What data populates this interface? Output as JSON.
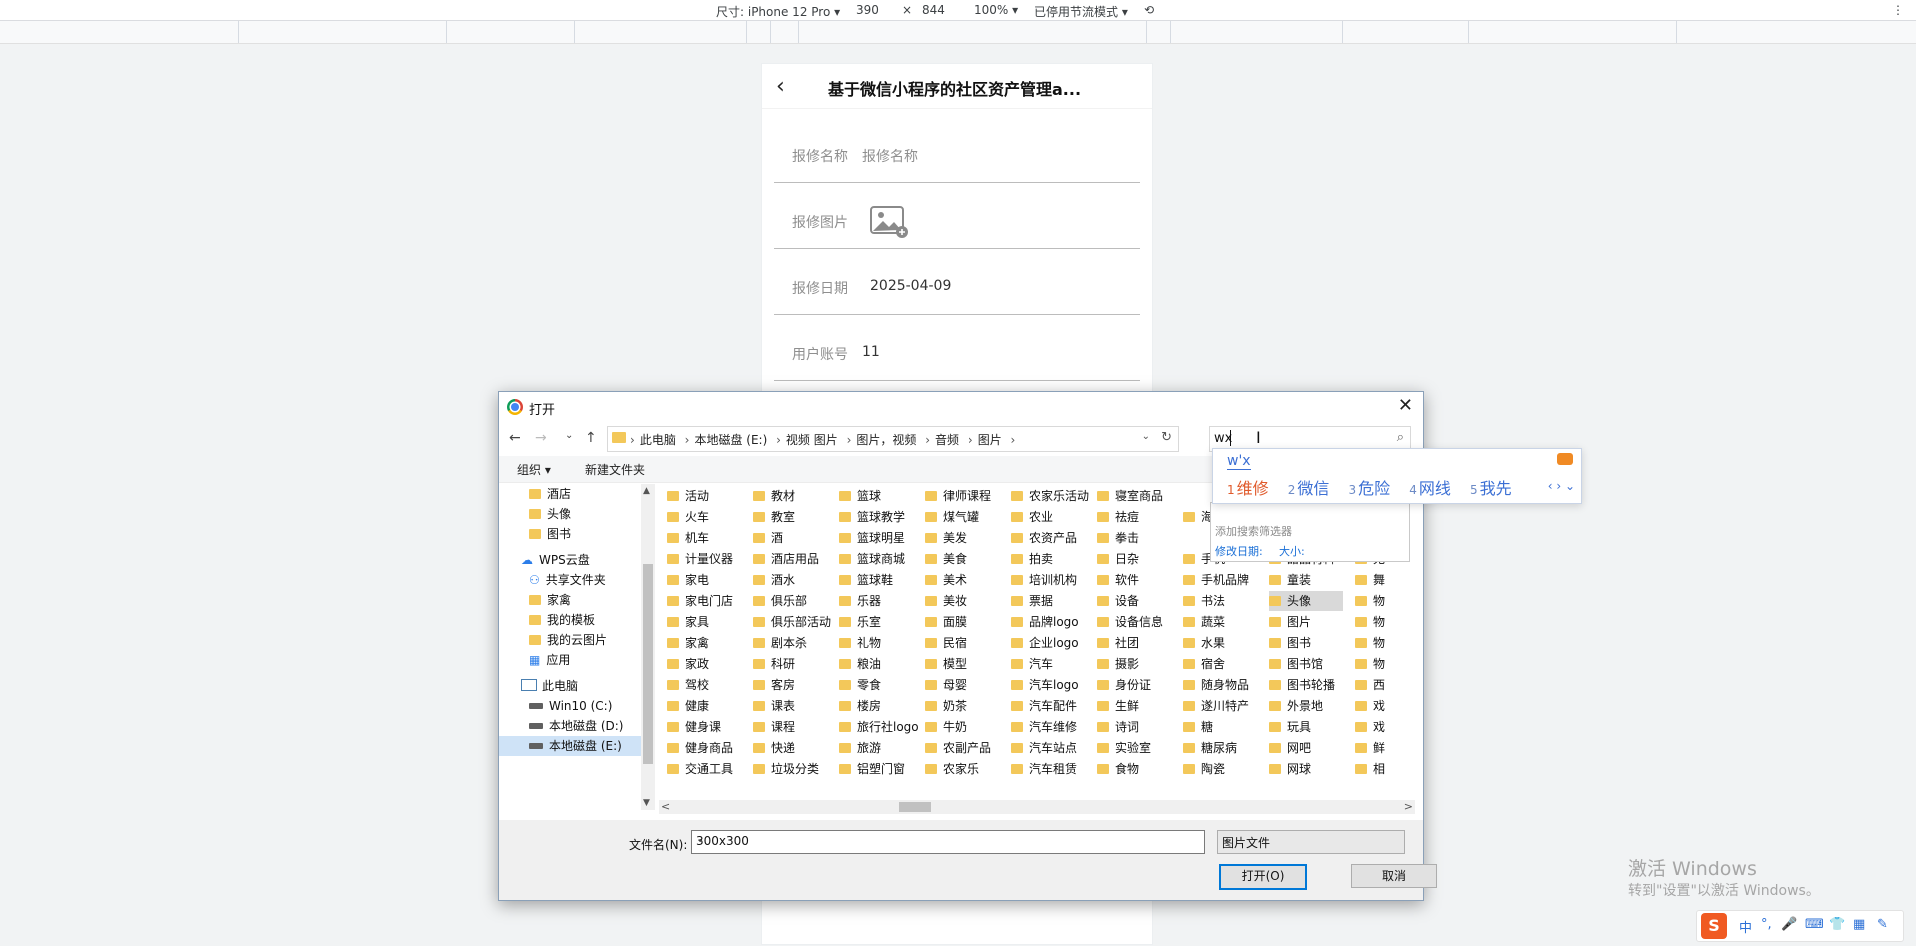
{
  "devtools": {
    "device": "尺寸: iPhone 12 Pro ▾",
    "width": "390",
    "times": "×",
    "height": "844",
    "zoom": "100% ▾",
    "throttle": "已停用节流模式 ▾",
    "rotate_icon": "rotate-icon",
    "more": "⋮"
  },
  "phone": {
    "back": "‹",
    "title": "基于微信小程序的社区资产管理a...",
    "rows": [
      {
        "label": "报修名称",
        "value": "报修名称",
        "placeholder": true
      },
      {
        "label": "报修图片",
        "value": "",
        "image": true
      },
      {
        "label": "报修日期",
        "value": "2025-04-09"
      },
      {
        "label": "用户账号",
        "value": "11"
      }
    ]
  },
  "dialog": {
    "title": "打开",
    "close": "✕",
    "nav": {
      "back": "←",
      "forward": "→",
      "recent": "⌄",
      "up": "↑"
    },
    "breadcrumbs": [
      "此电脑",
      "本地磁盘 (E:)",
      "视频 图片",
      "图片，视频",
      "音频",
      "图片"
    ],
    "search_value": "wx",
    "search_icon": "⌕",
    "refresh": "↻",
    "commands": {
      "organize": "组织 ▾",
      "new_folder": "新建文件夹"
    },
    "tree": [
      {
        "label": "酒店",
        "icon": "folder"
      },
      {
        "label": "头像",
        "icon": "folder"
      },
      {
        "label": "图书",
        "icon": "folder"
      },
      {
        "label": "WPS云盘",
        "icon": "cloud"
      },
      {
        "label": "共享文件夹",
        "icon": "share"
      },
      {
        "label": "家禽",
        "icon": "folder"
      },
      {
        "label": "我的模板",
        "icon": "folder"
      },
      {
        "label": "我的云图片",
        "icon": "folder"
      },
      {
        "label": "应用",
        "icon": "apps"
      },
      {
        "label": "此电脑",
        "icon": "pc"
      },
      {
        "label": "Win10 (C:)",
        "icon": "drive"
      },
      {
        "label": "本地磁盘 (D:)",
        "icon": "drive"
      },
      {
        "label": "本地磁盘 (E:)",
        "icon": "drive",
        "selected": true
      }
    ],
    "columns": [
      [
        "活动",
        "火车",
        "机车",
        "计量仪器",
        "家电",
        "家电门店",
        "家具",
        "家禽",
        "家政",
        "驾校",
        "健康",
        "健身课",
        "健身商品",
        "交通工具"
      ],
      [
        "教材",
        "教室",
        "酒",
        "酒店用品",
        "酒水",
        "俱乐部",
        "俱乐部活动",
        "剧本杀",
        "科研",
        "客房",
        "课表",
        "课程",
        "快递",
        "垃圾分类"
      ],
      [
        "篮球",
        "篮球教学",
        "篮球明星",
        "篮球商城",
        "篮球鞋",
        "乐器",
        "乐室",
        "礼物",
        "粮油",
        "零食",
        "楼房",
        "旅行社logo",
        "旅游",
        "铝塑门窗"
      ],
      [
        "律师课程",
        "煤气罐",
        "美发",
        "美食",
        "美术",
        "美妆",
        "面膜",
        "民宿",
        "模型",
        "母婴",
        "奶茶",
        "牛奶",
        "农副产品",
        "农家乐"
      ],
      [
        "农家乐活动",
        "农业",
        "农资产品",
        "拍卖",
        "培训机构",
        "票据",
        "品牌logo",
        "企业logo",
        "汽车",
        "汽车logo",
        "汽车配件",
        "汽车维修",
        "汽车站点",
        "汽车租赁"
      ],
      [
        "寝室商品",
        "祛痘",
        "拳击",
        "日杂",
        "软件",
        "设备",
        "设备信息",
        "社团",
        "摄影",
        "身份证",
        "生鲜",
        "诗词",
        "实验室",
        "食物"
      ],
      [
        "",
        "海",
        "",
        "手机",
        "手机品牌",
        "书法",
        "蔬菜",
        "水果",
        "宿舍",
        "随身物品",
        "遂川特产",
        "糖",
        "糖尿病",
        "陶瓷"
      ],
      [
        "",
        "",
        "",
        "甜品材料",
        "童装",
        "头像",
        "图片",
        "图书",
        "图书馆",
        "图书轮播",
        "外景地",
        "玩具",
        "网吧",
        "网球"
      ],
      [
        "",
        "国",
        "温",
        "无",
        "舞",
        "物",
        "物",
        "物",
        "物",
        "西",
        "戏",
        "戏",
        "鲜",
        "相"
      ]
    ],
    "selected_file": "头像",
    "scroll_left": "<",
    "scroll_right": ">",
    "filename_label": "文件名(N):",
    "filename": "300x300",
    "filetype": "图片文件",
    "open_button": "打开(O)",
    "cancel_button": "取消"
  },
  "ime": {
    "composition": "w'x",
    "candidates": [
      {
        "n": "1",
        "text": "维修"
      },
      {
        "n": "2",
        "text": "微信"
      },
      {
        "n": "3",
        "text": "危险"
      },
      {
        "n": "4",
        "text": "网线"
      },
      {
        "n": "5",
        "text": "我先"
      }
    ],
    "arrows": "‹ › ⌄"
  },
  "filter_popup": {
    "hint": "添加搜索筛选器",
    "modified": "修改日期:",
    "size": "大小:"
  },
  "watermark": {
    "line1": "激活 Windows",
    "line2": "转到\"设置\"以激活 Windows。"
  },
  "tray": {
    "logo": "S",
    "items": [
      "中",
      "°,",
      "🎤",
      "⌨",
      "👕",
      "▦",
      "✎"
    ]
  }
}
